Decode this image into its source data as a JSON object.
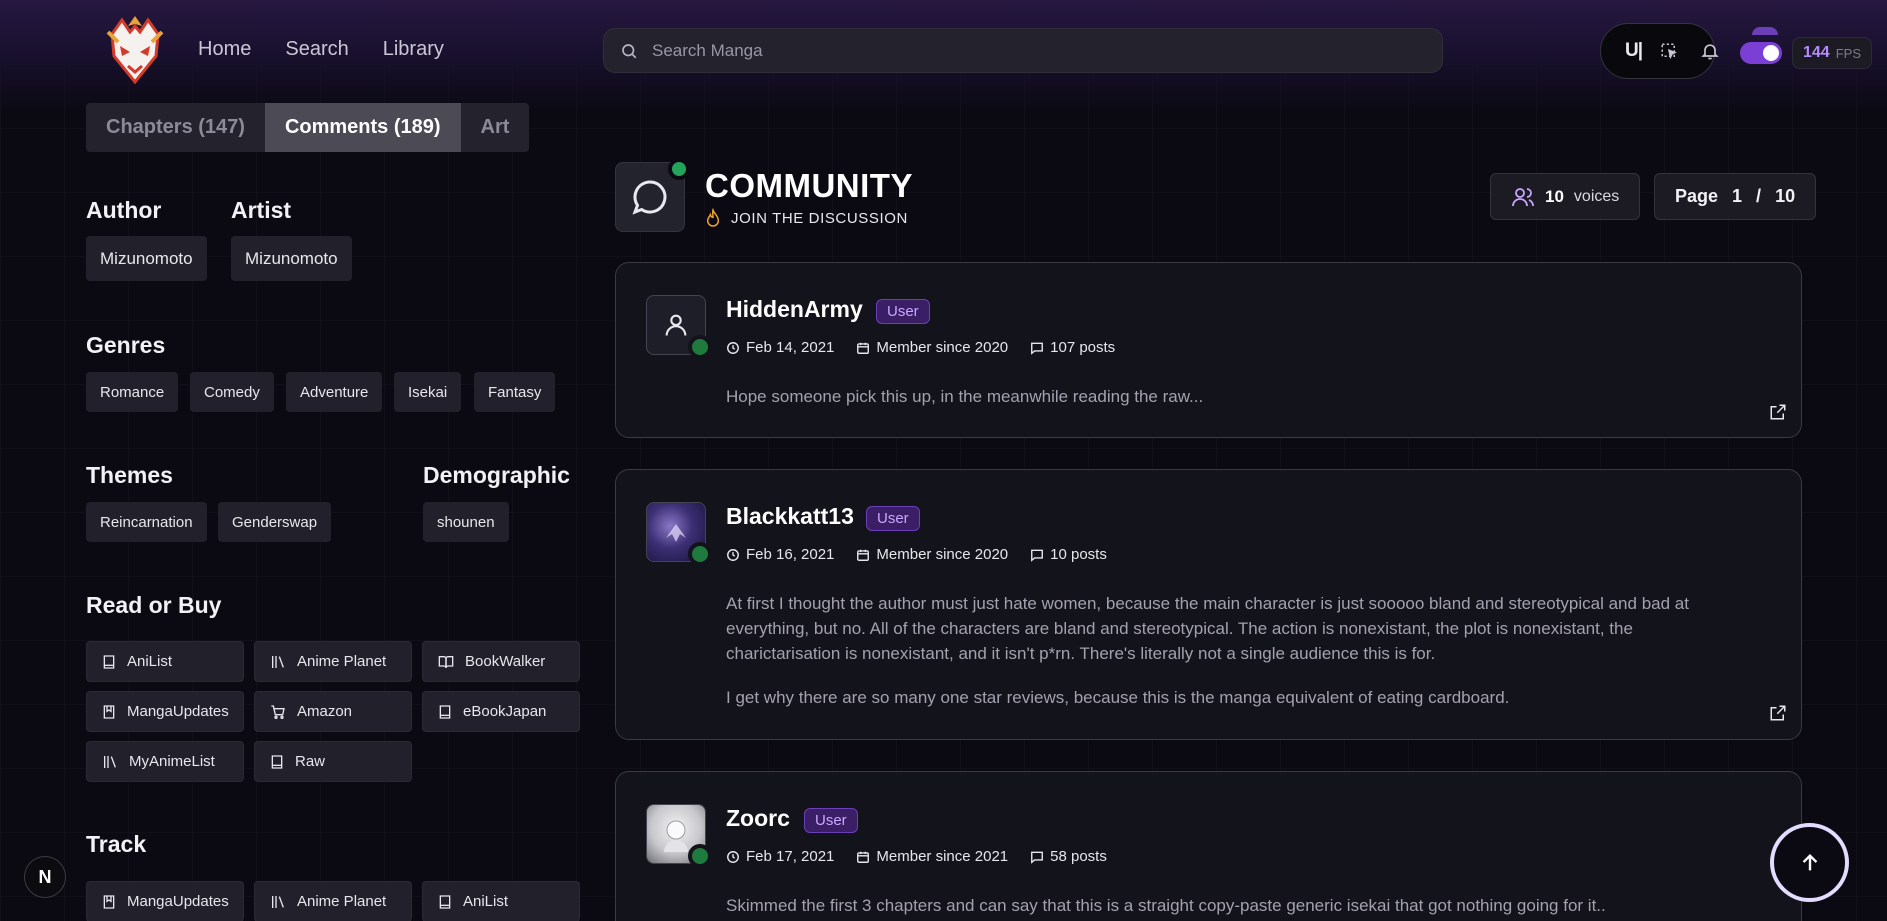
{
  "nav": {
    "home": "Home",
    "search": "Search",
    "library": "Library"
  },
  "search": {
    "placeholder": "Search Manga"
  },
  "toolbar": {
    "ui_label": "U|",
    "fps_value": "144",
    "fps_label": "FPS",
    "dark_mode_on": true
  },
  "tabs": [
    {
      "label": "Chapters (147)",
      "active": false
    },
    {
      "label": "Comments (189)",
      "active": true
    },
    {
      "label": "Art",
      "active": false
    }
  ],
  "sidebar": {
    "author_title": "Author",
    "author": "Mizunomoto",
    "artist_title": "Artist",
    "artist": "Mizunomoto",
    "genres_title": "Genres",
    "genres": [
      "Romance",
      "Comedy",
      "Adventure",
      "Isekai",
      "Fantasy"
    ],
    "themes_title": "Themes",
    "themes": [
      "Reincarnation",
      "Genderswap"
    ],
    "demographic_title": "Demographic",
    "demographic": "shounen",
    "read_title": "Read or Buy",
    "read_links": [
      "AniList",
      "Anime Planet",
      "BookWalker",
      "MangaUpdates",
      "Amazon",
      "eBookJapan",
      "MyAnimeList",
      "Raw"
    ],
    "track_title": "Track",
    "track_links": [
      "MangaUpdates",
      "Anime Planet",
      "AniList"
    ]
  },
  "community": {
    "title": "COMMUNITY",
    "subtitle": "JOIN THE DISCUSSION",
    "voices_count": "10",
    "voices_label": "voices",
    "page_label": "Page",
    "page_current": "1",
    "page_sep": "/",
    "page_total": "10"
  },
  "comments": [
    {
      "user": "HiddenArmy",
      "role": "User",
      "date": "Feb 14, 2021",
      "member_since": "Member since 2020",
      "posts": "107 posts",
      "paragraphs": [
        "Hope someone pick this up, in the meanwhile reading the raw..."
      ]
    },
    {
      "user": "Blackkatt13",
      "role": "User",
      "date": "Feb 16, 2021",
      "member_since": "Member since 2020",
      "posts": "10 posts",
      "paragraphs": [
        "At first I thought the author must just hate women, because the main character is just sooooo bland and stereotypical and bad at everything, but no. All of the characters are bland and stereotypical. The action is nonexistant, the plot is nonexistant, the charictarisation is nonexistant, and it isn't p*rn. There's literally not a single audience this is for.",
        "I get why there are so many one star reviews, because this is the manga equivalent of eating cardboard."
      ]
    },
    {
      "user": "Zoorc",
      "role": "User",
      "date": "Feb 17, 2021",
      "member_since": "Member since 2021",
      "posts": "58 posts",
      "paragraphs": [
        "Skimmed the first 3 chapters and can say that this is a straight copy-paste generic isekai that got nothing going for it.."
      ]
    }
  ],
  "misc": {
    "n_badge": "N"
  }
}
